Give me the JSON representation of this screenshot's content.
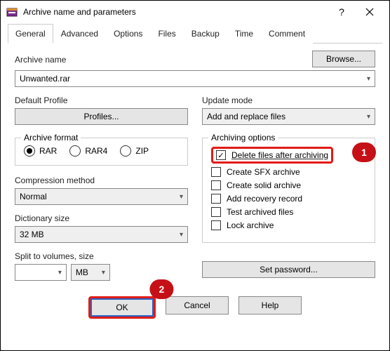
{
  "window": {
    "title": "Archive name and parameters"
  },
  "tabs": {
    "general": "General",
    "advanced": "Advanced",
    "options": "Options",
    "files": "Files",
    "backup": "Backup",
    "time": "Time",
    "comment": "Comment"
  },
  "archive_name": {
    "label": "Archive name",
    "value": "Unwanted.rar",
    "browse": "Browse..."
  },
  "default_profile": {
    "label": "Default Profile",
    "button": "Profiles..."
  },
  "update_mode": {
    "label": "Update mode",
    "value": "Add and replace files"
  },
  "archive_format": {
    "label": "Archive format",
    "rar": "RAR",
    "rar4": "RAR4",
    "zip": "ZIP"
  },
  "compression": {
    "label": "Compression method",
    "value": "Normal"
  },
  "dictionary": {
    "label": "Dictionary size",
    "value": "32 MB"
  },
  "split": {
    "label": "Split to volumes, size",
    "value": "",
    "unit": "MB"
  },
  "archiving_options": {
    "label": "Archiving options",
    "delete": "Delete files after archiving",
    "sfx": "Create SFX archive",
    "solid": "Create solid archive",
    "recovery": "Add recovery record",
    "test": "Test archived files",
    "lock": "Lock archive"
  },
  "set_password": "Set password...",
  "buttons": {
    "ok": "OK",
    "cancel": "Cancel",
    "help": "Help"
  },
  "callouts": {
    "one": "1",
    "two": "2"
  }
}
